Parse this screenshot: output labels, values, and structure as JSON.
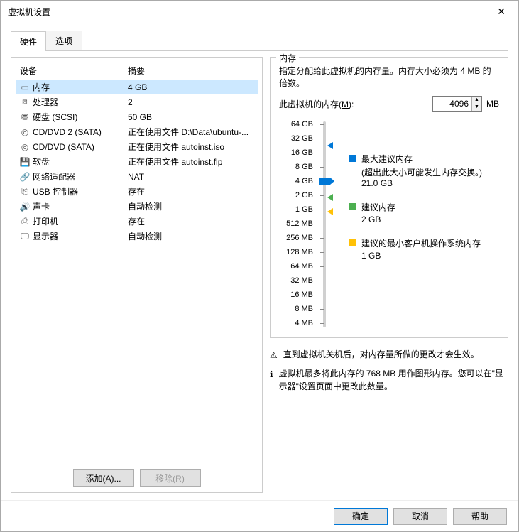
{
  "window": {
    "title": "虚拟机设置"
  },
  "tabs": {
    "hardware": "硬件",
    "options": "选项"
  },
  "hw": {
    "col_device": "设备",
    "col_summary": "摘要",
    "rows": [
      {
        "icon": "memory-icon",
        "name": "内存",
        "summary": "4 GB",
        "selected": true
      },
      {
        "icon": "cpu-icon",
        "name": "处理器",
        "summary": "2"
      },
      {
        "icon": "disk-icon",
        "name": "硬盘 (SCSI)",
        "summary": "50 GB"
      },
      {
        "icon": "cd-icon",
        "name": "CD/DVD 2 (SATA)",
        "summary": "正在使用文件 D:\\Data\\ubuntu-..."
      },
      {
        "icon": "cd-icon",
        "name": "CD/DVD (SATA)",
        "summary": "正在使用文件 autoinst.iso"
      },
      {
        "icon": "floppy-icon",
        "name": "软盘",
        "summary": "正在使用文件 autoinst.flp"
      },
      {
        "icon": "net-icon",
        "name": "网络适配器",
        "summary": "NAT"
      },
      {
        "icon": "usb-icon",
        "name": "USB 控制器",
        "summary": "存在"
      },
      {
        "icon": "sound-icon",
        "name": "声卡",
        "summary": "自动检测"
      },
      {
        "icon": "printer-icon",
        "name": "打印机",
        "summary": "存在"
      },
      {
        "icon": "display-icon",
        "name": "显示器",
        "summary": "自动检测"
      }
    ],
    "add_btn": "添加(A)...",
    "remove_btn": "移除(R)"
  },
  "mem": {
    "group_title": "内存",
    "desc": "指定分配给此虚拟机的内存量。内存大小必须为 4 MB 的倍数。",
    "label_pre": "此虚拟机的内存(",
    "label_u": "M",
    "label_post": "):",
    "value": "4096",
    "unit": "MB",
    "ticks": [
      "64 GB",
      "32 GB",
      "16 GB",
      "8 GB",
      "4 GB",
      "2 GB",
      "1 GB",
      "512 MB",
      "256 MB",
      "128 MB",
      "64 MB",
      "32 MB",
      "16 MB",
      "8 MB",
      "4 MB"
    ],
    "legend": {
      "max": {
        "title": "最大建议内存",
        "note": "(超出此大小可能发生内存交换。)",
        "value": "21.0 GB"
      },
      "rec": {
        "title": "建议内存",
        "value": "2 GB"
      },
      "min": {
        "title": "建议的最小客户机操作系统内存",
        "value": "1 GB"
      }
    }
  },
  "notes": {
    "warn": "直到虚拟机关机后，对内存量所做的更改才会生效。",
    "info": "虚拟机最多将此内存的 768 MB 用作图形内存。您可以在\"显示器\"设置页面中更改此数量。"
  },
  "footer": {
    "ok": "确定",
    "cancel": "取消",
    "help": "帮助"
  }
}
